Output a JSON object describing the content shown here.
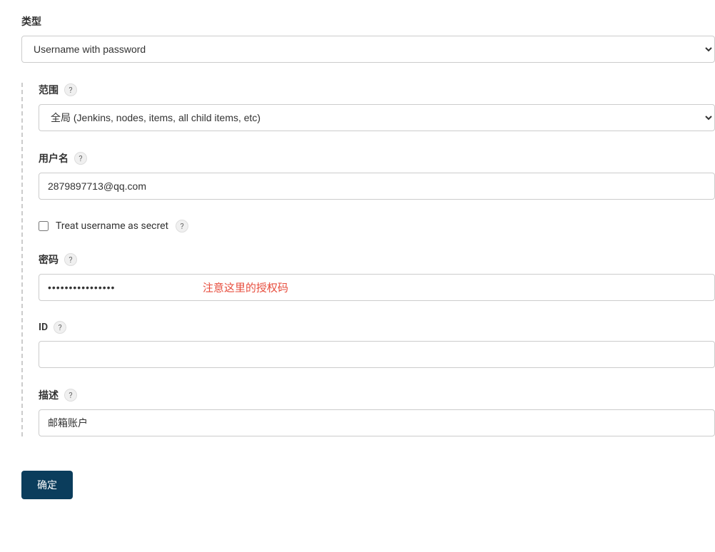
{
  "type": {
    "label": "类型",
    "value": "Username with password"
  },
  "scope": {
    "label": "范围",
    "value": "全局 (Jenkins, nodes, items, all child items, etc)"
  },
  "username": {
    "label": "用户名",
    "value": "2879897713@qq.com"
  },
  "treatSecret": {
    "label": "Treat username as secret"
  },
  "password": {
    "label": "密码",
    "value": "••••••••••••••••",
    "annotation": "注意这里的授权码"
  },
  "id": {
    "label": "ID",
    "value": ""
  },
  "description": {
    "label": "描述",
    "value": "邮箱账户"
  },
  "submit": {
    "label": "确定"
  },
  "helpChar": "?"
}
